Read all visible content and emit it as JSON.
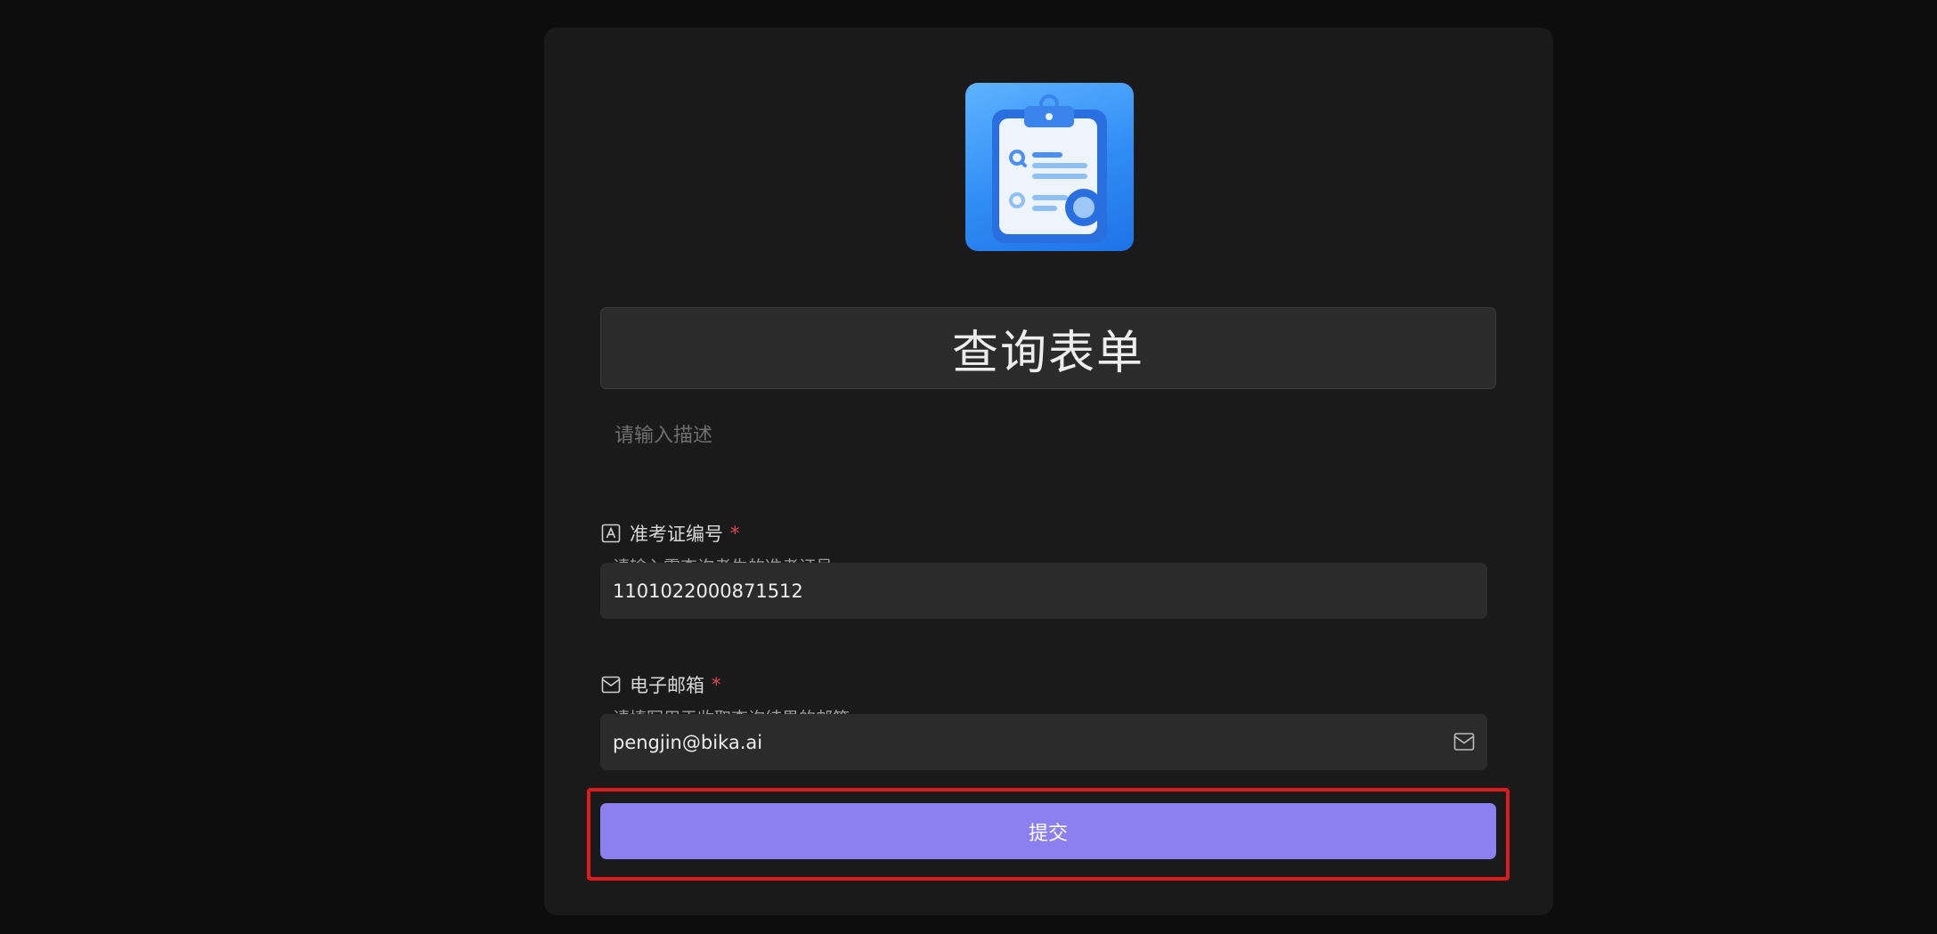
{
  "form": {
    "title": "查询表单",
    "description_placeholder": "请输入描述",
    "logo_icon": "clipboard-search-icon",
    "fields": [
      {
        "icon": "text-field-icon",
        "label": "准考证编号",
        "required_mark": "*",
        "help": "请输入需查询考生的准考证号",
        "value": "1101022000871512"
      },
      {
        "icon": "mail-icon",
        "label": "电子邮箱",
        "required_mark": "*",
        "help": "请填写用于收取查询结果的邮箱",
        "value": "pengjin@bika.ai",
        "trailing_icon": "mail-icon"
      }
    ],
    "submit_label": "提交"
  },
  "colors": {
    "background": "#0d0d0d",
    "card": "#1a1a1a",
    "input": "#2b2b2b",
    "accent": "#8c7fef",
    "required": "#e5484d",
    "highlight": "#e0191a"
  }
}
